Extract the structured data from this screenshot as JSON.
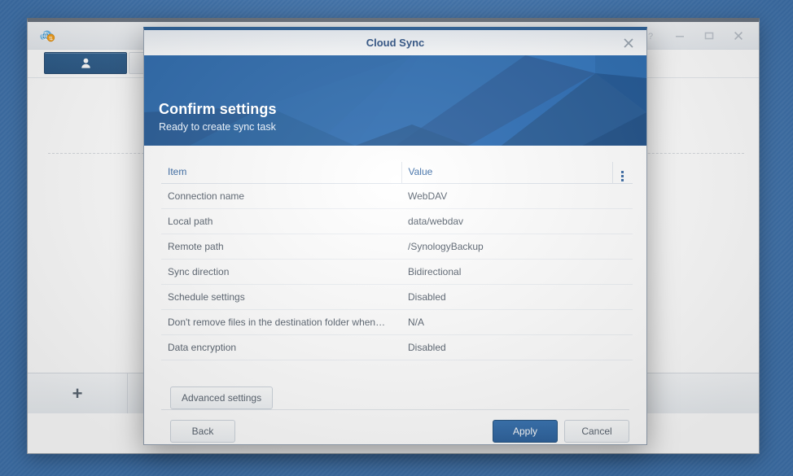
{
  "desktop": {
    "background_color": "#3e72ac"
  },
  "app_window": {
    "icon_name": "cloud-sync-app-icon",
    "window_controls": [
      {
        "name": "help-button",
        "glyph": "?"
      },
      {
        "name": "minimize-button",
        "glyph": "—"
      },
      {
        "name": "maximize-button",
        "glyph": "□"
      },
      {
        "name": "close-button",
        "glyph": "✕"
      }
    ],
    "tabs": [
      {
        "name": "tab-user-account",
        "icon": "user-icon",
        "selected": true
      },
      {
        "name": "tab-secondary",
        "icon": "",
        "selected": false
      }
    ],
    "footer": {
      "add_label": "+"
    }
  },
  "dialog": {
    "title": "Cloud Sync",
    "close_glyph": "✕",
    "banner": {
      "heading": "Confirm settings",
      "subheading": "Ready to create sync task",
      "accent_color": "#2c69ab"
    },
    "table": {
      "columns": [
        "Item",
        "Value"
      ],
      "menu_icon": "kebab-menu-icon",
      "rows": [
        {
          "item": "Connection name",
          "value": "WebDAV"
        },
        {
          "item": "Local path",
          "value": "data/webdav"
        },
        {
          "item": "Remote path",
          "value": "/SynologyBackup"
        },
        {
          "item": "Sync direction",
          "value": "Bidirectional"
        },
        {
          "item": "Schedule settings",
          "value": "Disabled"
        },
        {
          "item": "Don't remove files in the destination folder when…",
          "value": "N/A"
        },
        {
          "item": "Data encryption",
          "value": "Disabled"
        }
      ]
    },
    "buttons": {
      "advanced_settings": "Advanced settings",
      "back": "Back",
      "apply": "Apply",
      "cancel": "Cancel"
    }
  }
}
